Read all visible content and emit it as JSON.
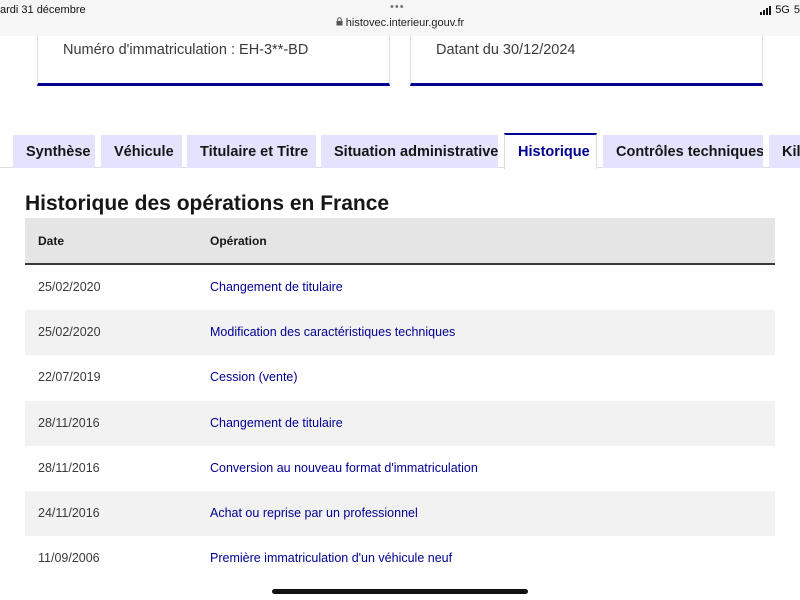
{
  "status_bar": {
    "date": "ardi 31 décembre",
    "dots": "•••",
    "url": "histovec.interieur.gouv.fr",
    "network": "5G",
    "battery_fragment": "5"
  },
  "cards": [
    {
      "text": "Numéro d'immatriculation : EH-3**-BD"
    },
    {
      "text": "Datant du 30/12/2024"
    }
  ],
  "tabs": [
    {
      "label": "Synthèse"
    },
    {
      "label": "Véhicule"
    },
    {
      "label": "Titulaire et Titre"
    },
    {
      "label": "Situation administrative"
    },
    {
      "label": "Historique",
      "active": true
    },
    {
      "label": "Contrôles techniques"
    },
    {
      "label": "Kilo"
    }
  ],
  "history": {
    "title": "Historique des opérations en France",
    "columns": {
      "date": "Date",
      "operation": "Opération"
    },
    "rows": [
      {
        "date": "25/02/2020",
        "operation": "Changement de titulaire"
      },
      {
        "date": "25/02/2020",
        "operation": "Modification des caractéristiques techniques"
      },
      {
        "date": "22/07/2019",
        "operation": "Cession (vente)"
      },
      {
        "date": "28/11/2016",
        "operation": "Changement de titulaire"
      },
      {
        "date": "28/11/2016",
        "operation": "Conversion au nouveau format d'immatriculation"
      },
      {
        "date": "24/11/2016",
        "operation": "Achat ou reprise par un professionnel"
      },
      {
        "date": "11/09/2006",
        "operation": "Première immatriculation d'un véhicule neuf"
      }
    ]
  },
  "colors": {
    "accent": "#000091",
    "tab_bg": "#e3e3fd",
    "header_bg": "#e5e5e5",
    "stripe_bg": "#f2f2f2"
  }
}
